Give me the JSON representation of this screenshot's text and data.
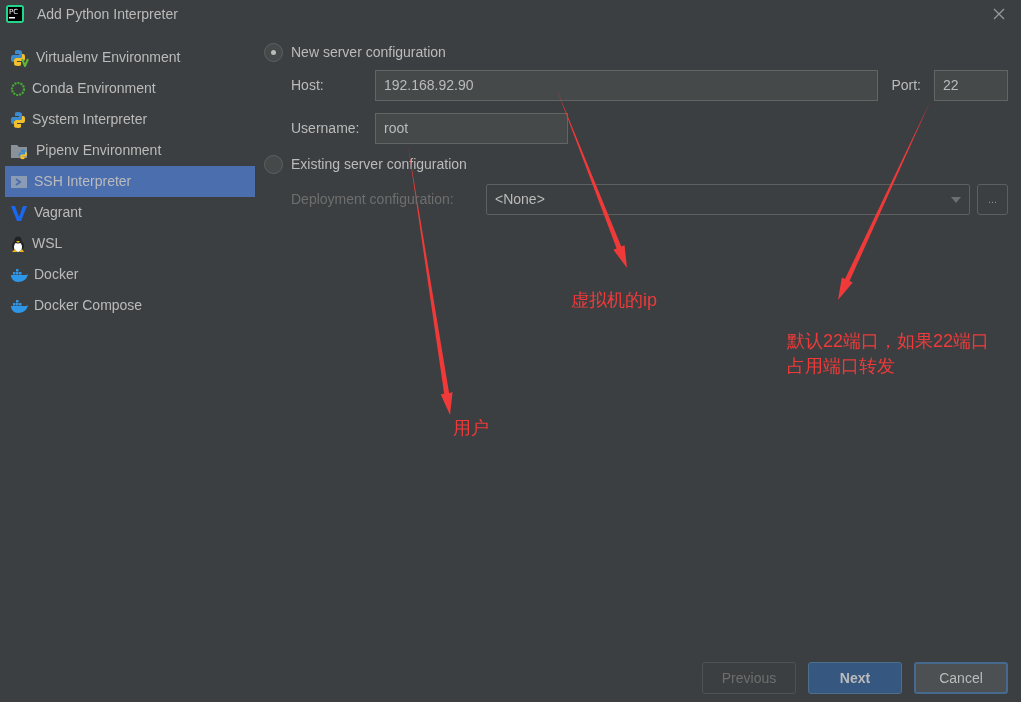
{
  "window": {
    "title": "Add Python Interpreter",
    "logo_text": "PC"
  },
  "sidebar": {
    "items": [
      {
        "label": "Virtualenv Environment",
        "kind": "virtualenv",
        "selected": false
      },
      {
        "label": "Conda Environment",
        "kind": "conda",
        "selected": false
      },
      {
        "label": "System Interpreter",
        "kind": "python",
        "selected": false
      },
      {
        "label": "Pipenv Environment",
        "kind": "pipenv",
        "selected": false
      },
      {
        "label": "SSH Interpreter",
        "kind": "ssh",
        "selected": true
      },
      {
        "label": "Vagrant",
        "kind": "vagrant",
        "selected": false
      },
      {
        "label": "WSL",
        "kind": "wsl",
        "selected": false
      },
      {
        "label": "Docker",
        "kind": "docker",
        "selected": false
      },
      {
        "label": "Docker Compose",
        "kind": "docker",
        "selected": false
      }
    ]
  },
  "new_server": {
    "label": "New server configuration",
    "selected": true,
    "host_label": "Host:",
    "host": "192.168.92.90",
    "port_label": "Port:",
    "port": "22",
    "username_label": "Username:",
    "username": "root"
  },
  "existing_server": {
    "label": "Existing server configuration",
    "selected": false,
    "deployment_label": "Deployment configuration:",
    "deployment": "<None>",
    "browse": "...",
    "disabled": true
  },
  "annotations": [
    {
      "lines": [
        "虚拟机的ip"
      ]
    },
    {
      "lines": [
        "默认22端口，如果22端口",
        "占用端口转发"
      ]
    },
    {
      "lines": [
        "用户"
      ]
    }
  ],
  "buttons": [
    {
      "label": "Previous",
      "disabled": true,
      "default": false
    },
    {
      "label": "Next",
      "disabled": false,
      "default": true
    },
    {
      "label": "Cancel",
      "disabled": false,
      "default": false
    }
  ]
}
